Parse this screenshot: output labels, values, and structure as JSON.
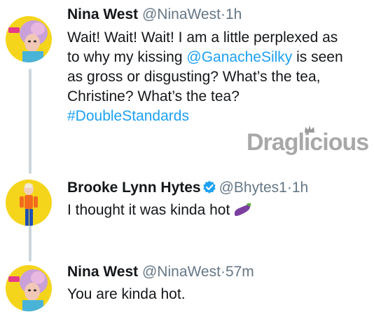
{
  "tweets": [
    {
      "name": "Nina West",
      "handle": "@NinaWest",
      "separator": "·",
      "time": "1h",
      "lines": [
        {
          "pre": "Wait! Wait! Wait! I am a little perplexed as"
        },
        {
          "pre": "to why my kissing ",
          "link": "@GanacheSilky",
          "post": " is seen"
        },
        {
          "pre": "as gross or disgusting? What’s the tea,"
        },
        {
          "pre": "Christine? What’s the tea?"
        },
        {
          "link": "#DoubleStandards"
        }
      ],
      "avatar_icon": "drag-queen-avatar"
    },
    {
      "name": "Brooke Lynn Hytes",
      "handle": "@Bhytes1",
      "separator": "·",
      "time": "1h",
      "text": "I thought it was kinda hot",
      "emoji": "eggplant-emoji",
      "verified": true,
      "avatar_icon": "drag-queen-avatar-orange"
    },
    {
      "name": "Nina West",
      "handle": "@NinaWest",
      "separator": "·",
      "time": "57m",
      "text": "You are kinda hot.",
      "avatar_icon": "drag-queen-avatar"
    }
  ],
  "watermark": {
    "text": "Draglicious"
  },
  "colors": {
    "link": "#1da1f2",
    "secondary": "#657786",
    "thread_line": "#ccd6dd",
    "verified": "#1da1f2"
  }
}
